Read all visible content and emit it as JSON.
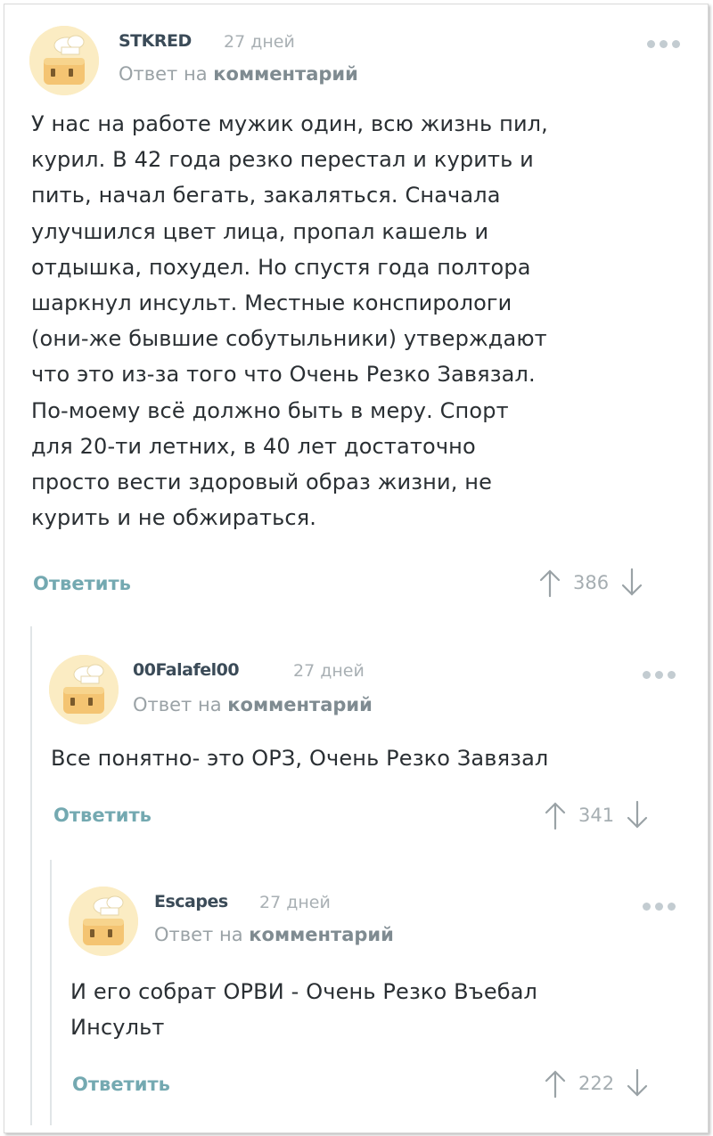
{
  "comments": [
    {
      "author": "STKRED",
      "time": "27 дней",
      "reply_prefix": "Ответ на",
      "reply_link": "комментарий",
      "lines": [
        "У нас на работе мужик один, всю жизнь пил,",
        "курил. В 42 года резко перестал и курить и",
        "пить, начал бегать, закаляться. Сначала",
        "улучшился цвет лица, пропал кашель и",
        "отдышка, похудел. Но спустя года полтора",
        "шаркнул инсульт. Местные конспирологи",
        "(они-же бывшие собутыльники) утверждают",
        "что это из-за того что Очень Резко Завязал.",
        "По-моему всё должно быть в меру. Спорт",
        "для 20-ти летних, в 40 лет достаточно",
        "просто вести здоровый образ жизни, не",
        "курить и не обжираться."
      ],
      "reply_label": "Ответить",
      "rating": "386"
    },
    {
      "author": "00Falafel00",
      "time": "27 дней",
      "reply_prefix": "Ответ на",
      "reply_link": "комментарий",
      "lines": [
        "Все понятно- это ОРЗ, Очень Резко Завязал"
      ],
      "reply_label": "Ответить",
      "rating": "341"
    },
    {
      "author": "Escapes",
      "time": "27 дней",
      "reply_prefix": "Ответ на",
      "reply_link": "комментарий",
      "lines": [
        "И его собрат ОРВИ - Очень Резко Въебал",
        "Инсульт"
      ],
      "reply_label": "Ответить",
      "rating": "222"
    }
  ],
  "icons": {
    "avatar": "chef-toaster-avatar",
    "more": "more-dots-icon",
    "upvote": "arrow-up-icon",
    "downvote": "arrow-down-icon"
  },
  "colors": {
    "author": "#3b4b58",
    "reply_button": "#74a9b1",
    "muted": "#a9b0b4"
  }
}
